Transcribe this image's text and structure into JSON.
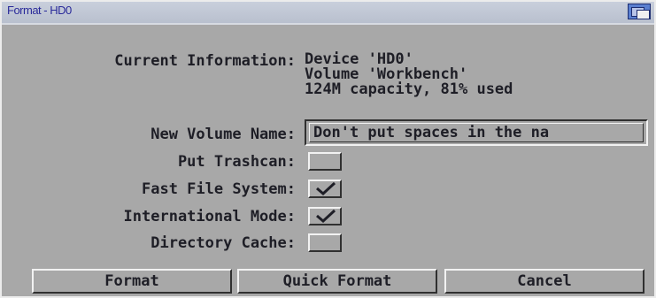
{
  "window": {
    "title": "Format - HD0"
  },
  "current_info": {
    "label": "Current Information:",
    "device": "Device 'HD0'",
    "volume": "Volume 'Workbench'",
    "capacity": "124M capacity, 81% used"
  },
  "fields": {
    "volume_name_label": "New Volume Name:",
    "volume_name_value": "Don't put spaces in the na"
  },
  "options": [
    {
      "label": "Put Trashcan:",
      "checked": false
    },
    {
      "label": "Fast File System:",
      "checked": true
    },
    {
      "label": "International Mode:",
      "checked": true
    },
    {
      "label": "Directory Cache:",
      "checked": false
    }
  ],
  "buttons": {
    "format": "Format",
    "quick_format": "Quick Format",
    "cancel": "Cancel"
  },
  "colors": {
    "window_bg": "#a8a8a8",
    "text": "#1e1e26",
    "title_text": "#2a2a9a",
    "shine": "#f2f2f2",
    "shadow": "#303030"
  }
}
